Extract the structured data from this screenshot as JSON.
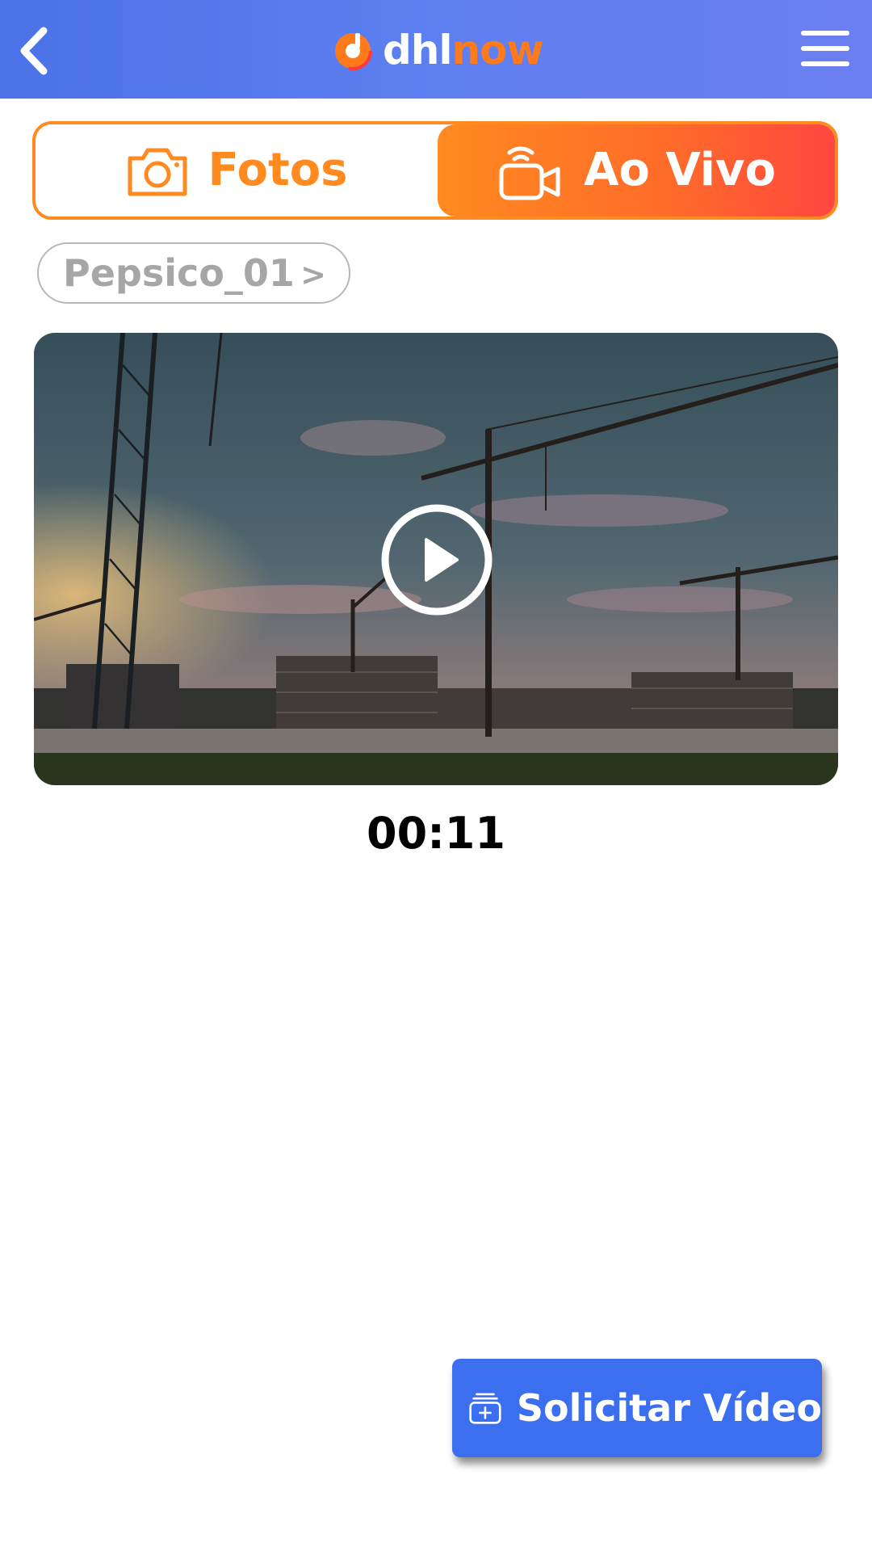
{
  "header": {
    "logo_part1": "dhl",
    "logo_part2": "now",
    "back_icon": "chevron-left-icon",
    "menu_icon": "hamburger-menu-icon"
  },
  "tabs": [
    {
      "label": "Fotos",
      "icon": "camera-icon",
      "active": false
    },
    {
      "label": "Ao Vivo",
      "icon": "video-camera-icon",
      "active": true
    }
  ],
  "camera_selector": {
    "name": "Pepsico_01",
    "chevron": ">"
  },
  "video": {
    "play_icon": "play-icon",
    "timer": "00:11"
  },
  "request_button": {
    "label": "Solicitar Vídeo",
    "icon": "add-video-icon"
  },
  "colors": {
    "header_blue": "#5e7ff0",
    "accent_orange": "#ff8a1f",
    "accent_red": "#ff4640",
    "button_blue": "#3b6ff0",
    "pill_gray": "#a6a6a6"
  }
}
